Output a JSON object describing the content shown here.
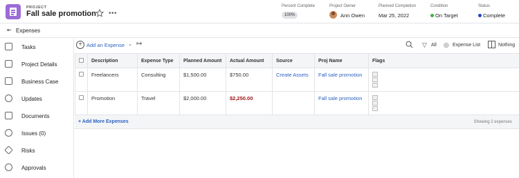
{
  "header": {
    "kicker": "PROJECT",
    "title": "Fall sale promotion",
    "more": "•••",
    "columns": {
      "percent": {
        "label": "Percent Complete",
        "value": "100%"
      },
      "owner": {
        "label": "Project Owner",
        "value": "Ann Owen"
      },
      "planned": {
        "label": "Planned Completion",
        "value": "Mar 25, 2022"
      },
      "condition": {
        "label": "Condition",
        "value": "On Target",
        "color": "#3cb043"
      },
      "status": {
        "label": "Status",
        "value": "Complete",
        "color": "#2441c5"
      }
    }
  },
  "subheader": {
    "back": "⇤",
    "title": "Expenses"
  },
  "sidebar": {
    "items": [
      {
        "label": "Tasks",
        "icon": "tasks-icon"
      },
      {
        "label": "Project Details",
        "icon": "details-icon"
      },
      {
        "label": "Business Case",
        "icon": "business-case-icon"
      },
      {
        "label": "Updates",
        "icon": "updates-icon"
      },
      {
        "label": "Documents",
        "icon": "documents-icon"
      },
      {
        "label": "Issues (0)",
        "icon": "issues-icon"
      },
      {
        "label": "Risks",
        "icon": "risks-icon"
      },
      {
        "label": "Approvals",
        "icon": "approvals-icon"
      }
    ]
  },
  "toolbar": {
    "add_label": "Add an Expense",
    "caret": "⌄",
    "export": "↦",
    "filter_label": "All",
    "view_label": "Expense List",
    "grid_label": "Nothing"
  },
  "table": {
    "headers": [
      "Description",
      "Expense Type",
      "Planned Amount",
      "Actual Amount",
      "Source",
      "Proj Name",
      "Flags"
    ],
    "rows": [
      {
        "description": "Freelancers",
        "type": "Consulting",
        "planned": "$1,500.00",
        "actual": "$750.00",
        "source": "Create Assets",
        "proj": "Fall sale promotion"
      },
      {
        "description": "Promotion",
        "type": "Travel",
        "planned": "$2,000.00",
        "actual": "$2,250.00",
        "source": "",
        "proj": "Fall sale promotion"
      }
    ]
  },
  "footer": {
    "more_label": "+ Add More Expenses",
    "showing": "Showing 2 expenses"
  }
}
